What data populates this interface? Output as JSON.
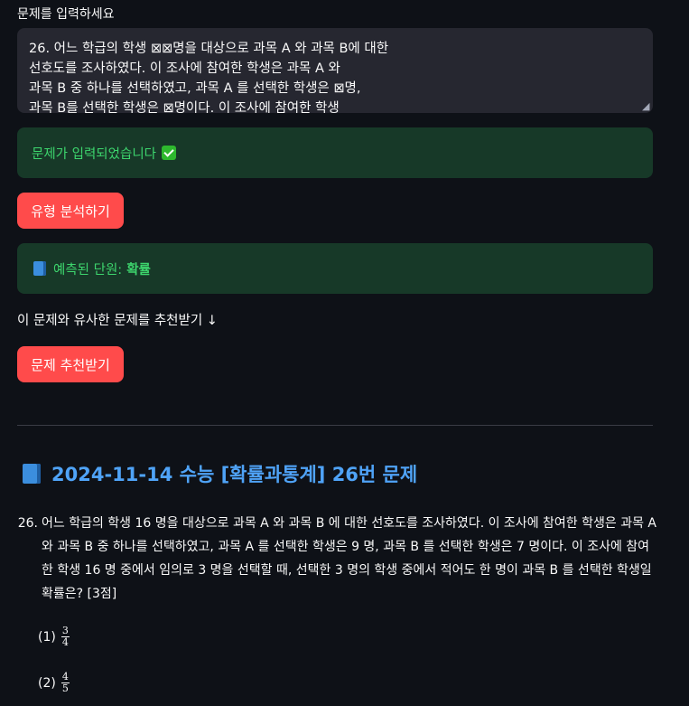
{
  "input": {
    "label": "문제를 입력하세요",
    "value": "26. 어느 학급의 학생 ⊠⊠명을 대상으로 과목 A 와 과목 B에 대한\n선호도를 조사하였다. 이 조사에 참여한 학생은 과목 A 와\n과목 B 중 하나를 선택하였고, 과목 A 를 선택한 학생은 ⊠명,\n과목 B를 선택한 학생은 ⊠명이다. 이 조사에 참여한 학생"
  },
  "success": {
    "message": "문제가 입력되었습니다",
    "icon": "check-icon"
  },
  "analyze_button": "유형 분석하기",
  "unit": {
    "label": "예측된 단원:",
    "value": "확률",
    "icon": "book-icon"
  },
  "recommend_prompt": "이 문제와 유사한 문제를 추천받기 ↓",
  "recommend_button": "문제 추천받기",
  "problem": {
    "heading": "2024-11-14 수능 [확률과통계] 26번 문제",
    "number": "26.",
    "text": "어느 학급의 학생 16 명을 대상으로 과목 A 와 과목 B 에 대한 선호도를 조사하였다. 이 조사에 참여한 학생은 과목 A 와 과목 B 중 하나를 선택하였고, 과목 A 를 선택한 학생은 9 명, 과목 B 를 선택한 학생은 7 명이다. 이 조사에 참여한 학생 16 명 중에서 임의로 3 명을 선택할 때, 선택한 3 명의 학생 중에서 적어도 한 명이 과목 B 를 선택한 학생일 확률은? [3점]",
    "choices": [
      {
        "label": "(1)",
        "num": "3",
        "den": "4"
      },
      {
        "label": "(2)",
        "num": "4",
        "den": "5"
      }
    ]
  },
  "colors": {
    "background": "#0e1117",
    "button": "#ff4b4b",
    "success_bg": "#173928",
    "success_text": "#3dd56d",
    "heading": "#4fa3f7"
  }
}
